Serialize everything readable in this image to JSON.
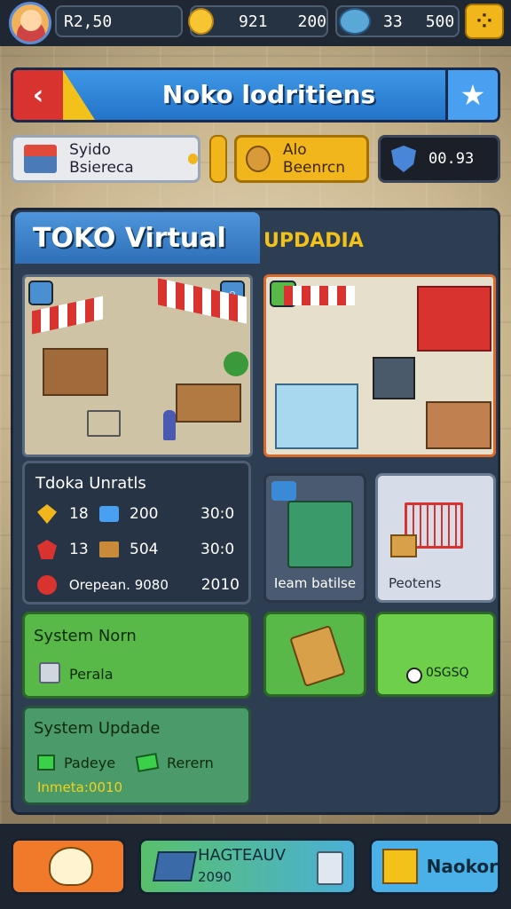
{
  "top_bar": {
    "cash": "R2,50",
    "gems_a": "921",
    "gems_b": "200",
    "stock_a": "33",
    "stock_b": "500"
  },
  "header": {
    "title": "Noko lodritiens"
  },
  "info_row": {
    "left_label": "Syido Bsiereca",
    "mid_label": "Alo Beenrcn",
    "right_value": "00.93"
  },
  "tabs": {
    "active": "TOKO Virtual",
    "inactive": "UPDADIA"
  },
  "stats_card": {
    "title": "Tdoka Unratls",
    "rows": [
      {
        "a": "18",
        "b": "200",
        "c": "30:0"
      },
      {
        "a": "13",
        "b": "504",
        "c": "30:0"
      },
      {
        "a": "Orepean. 9080",
        "b": "",
        "c": "2010"
      }
    ]
  },
  "item_cards": [
    {
      "label": "Ieam batilse"
    },
    {
      "label": "Peotens"
    }
  ],
  "system_norn": {
    "title": "System Norn",
    "item": "Perala"
  },
  "action_tiles": {
    "right_label": "0SGSQ"
  },
  "system_update": {
    "title": "System Updade",
    "item_a": "Padeye",
    "item_b": "Rerern",
    "footer": "Inmeta:0010"
  },
  "bottom_bar": {
    "mid_title": "HAGTEAUV",
    "mid_sub": "2090",
    "right_label": "Naokor"
  },
  "colors": {
    "accent_blue": "#2f78c9",
    "accent_yellow": "#f2b61d",
    "accent_green": "#58b848",
    "accent_red": "#d8332e"
  }
}
